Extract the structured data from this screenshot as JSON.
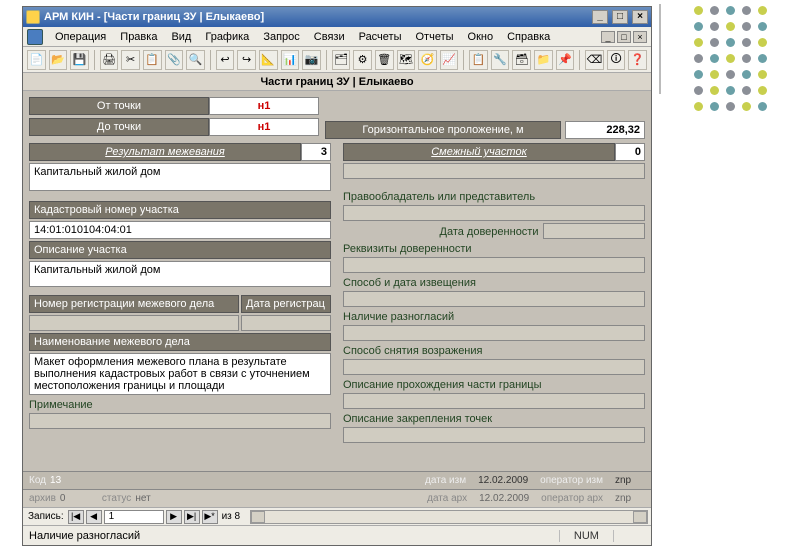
{
  "window": {
    "title": "АРМ КИН - [Части границ ЗУ | Елыкаево]",
    "min": "_",
    "restore": "□",
    "close": "×"
  },
  "menu": {
    "items": [
      "Операция",
      "Правка",
      "Вид",
      "Графика",
      "Запрос",
      "Связи",
      "Расчеты",
      "Отчеты",
      "Окно",
      "Справка"
    ]
  },
  "mdi": {
    "min": "_",
    "restore": "□",
    "close": "×"
  },
  "toolbar_icons": [
    "📄",
    "📂",
    "💾",
    "🖨",
    "✂",
    "📋",
    "📎",
    "🔍",
    "↩",
    "↪",
    "📐",
    "📊",
    "📷",
    "🗂",
    "⚙",
    "🗑",
    "🗺",
    "🧭",
    "📈",
    "📋",
    "🔧",
    "🗃",
    "📁",
    "📌",
    "⌫",
    "🛈",
    "❓"
  ],
  "doc_title": "Части границ ЗУ | Елыкаево",
  "top": {
    "from_label": "От точки",
    "from_value": "н1",
    "to_label": "До точки",
    "to_value": "н1",
    "horiz_label": "Горизонтальное проложение, м",
    "horiz_value": "228,32"
  },
  "left": {
    "survey_result_label": "Результат межевания",
    "survey_result_num": "3",
    "survey_result_value": "Капитальный жилой дом",
    "cadastre_label": "Кадастровый номер участка",
    "cadastre_value": "14:01:010104:04:01",
    "parcel_desc_label": "Описание участка",
    "parcel_desc_value": "Капитальный жилой дом",
    "reg_num_label": "Номер регистрации межевого дела",
    "reg_date_label": "Дата регистрац",
    "case_name_label": "Наименование межевого дела",
    "case_name_value": "Макет оформления межевого плана в результате выполнения кадастровых работ в связи с уточнением местоположения границы и площади",
    "note_label": "Примечание"
  },
  "right": {
    "adj_parcel_label": "Смежный участок",
    "adj_parcel_num": "0",
    "owner_label": "Правообладатель или представитель",
    "poa_date_label": "Дата доверенности",
    "poa_req_label": "Реквизиты доверенности",
    "notify_label": "Способ и дата извещения",
    "dispute_label": "Наличие разногласий",
    "objection_label": "Способ снятия возражения",
    "boundary_desc_label": "Описание прохождения части границы",
    "points_fix_label": "Описание закрепления точек"
  },
  "footer1": {
    "code_label": "Код",
    "code_value": "13",
    "date_mod_label": "дата изм",
    "date_mod_value": "12.02.2009",
    "oper_mod_label": "оператор изм",
    "oper_mod_value": "znp"
  },
  "footer2": {
    "arch_label": "архив",
    "arch_value": "0",
    "status_label": "статус",
    "status_value": "нет",
    "date_arch_label": "дата арх",
    "date_arch_value": "12.02.2009",
    "oper_arch_label": "оператор арх",
    "oper_arch_value": "znp"
  },
  "recnav": {
    "label": "Запись:",
    "current": "1",
    "of": "из 8",
    "first": "|◀",
    "prev": "◀",
    "next": "▶",
    "last": "▶|",
    "new": "▶*"
  },
  "status": {
    "text": "Наличие разногласий",
    "num": "NUM"
  },
  "deco_colors": [
    "#c8cf4e",
    "#8b8f97",
    "#6aa0a7",
    "#8b8f97",
    "#c8cf4e",
    "#6aa0a7",
    "#8b8f97",
    "#c8cf4e",
    "#8b8f97",
    "#6aa0a7",
    "#c8cf4e",
    "#8b8f97",
    "#6aa0a7",
    "#8b8f97",
    "#c8cf4e",
    "#8b8f97",
    "#6aa0a7",
    "#c8cf4e",
    "#8b8f97",
    "#6aa0a7",
    "#6aa0a7",
    "#c8cf4e",
    "#8b8f97",
    "#6aa0a7",
    "#c8cf4e",
    "#8b8f97",
    "#c8cf4e",
    "#6aa0a7",
    "#8b8f97",
    "#c8cf4e",
    "#c8cf4e",
    "#6aa0a7",
    "#8b8f97",
    "#c8cf4e",
    "#6aa0a7"
  ]
}
